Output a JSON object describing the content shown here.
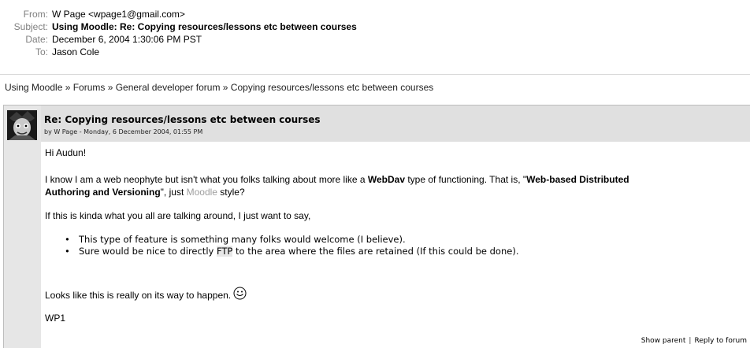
{
  "email_headers": {
    "from_label": "From:",
    "from_value": "W Page <wpage1@gmail.com>",
    "subject_label": "Subject:",
    "subject_value": "Using Moodle: Re: Copying resources/lessons etc between courses",
    "date_label": "Date:",
    "date_value": "December 6, 2004 1:30:06 PM PST",
    "to_label": "To:",
    "to_value": "Jason Cole"
  },
  "breadcrumb": {
    "text": "Using Moodle » Forums » General developer forum » Copying resources/lessons etc between courses"
  },
  "post": {
    "title": "Re: Copying resources/lessons etc between courses",
    "byline": "by W Page - Monday, 6 December 2004, 01:55 PM",
    "greeting": "Hi Audun!",
    "para1_a": "I know I am a web neophyte but isn't what you folks talking about more like a ",
    "para1_b": "WebDav",
    "para1_c": " type of functioning. That is, \"",
    "para1_d": "Web-based Distributed",
    "para1_e": "Authoring and Versioning",
    "para1_f": "\",  just ",
    "para1_g": "Moodle",
    "para1_h": " style?",
    "para2": "If this is kinda what you all are talking around, I just want to say,",
    "bullet1": "This type of feature is something many folks would welcome (I believe).",
    "bullet2_a": "Sure would be nice to directly ",
    "bullet2_b": "FTP",
    "bullet2_c": " to the area where the files are retained (If this could be done).",
    "para3": "Looks like this is really on its way to happen.",
    "signature": "WP1",
    "show_parent": "Show parent",
    "separator": "|",
    "reply": "Reply to forum"
  },
  "icons": {
    "smiley": "smiley-icon",
    "avatar": "user-avatar"
  }
}
